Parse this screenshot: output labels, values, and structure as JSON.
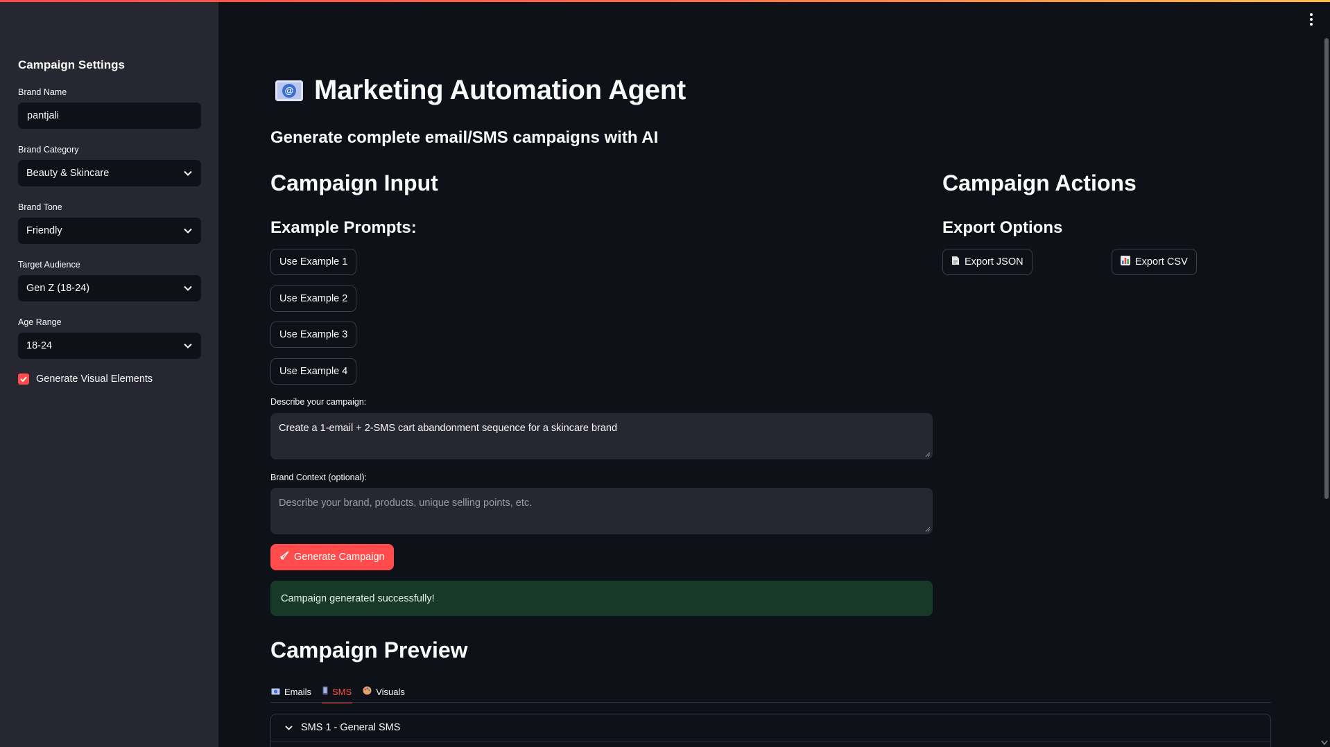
{
  "sidebar": {
    "title": "Campaign Settings",
    "brand_name": {
      "label": "Brand Name",
      "value": "pantjali"
    },
    "brand_category": {
      "label": "Brand Category",
      "value": "Beauty & Skincare"
    },
    "brand_tone": {
      "label": "Brand Tone",
      "value": "Friendly"
    },
    "target_audience": {
      "label": "Target Audience",
      "value": "Gen Z (18-24)"
    },
    "age_range": {
      "label": "Age Range",
      "value": "18-24"
    },
    "generate_visuals": {
      "label": "Generate Visual Elements",
      "checked": true
    }
  },
  "header": {
    "title": "Marketing Automation Agent",
    "subtitle": "Generate complete email/SMS campaigns with AI",
    "icon": "email-icon"
  },
  "campaign_input": {
    "heading": "Campaign Input",
    "examples_heading": "Example Prompts:",
    "examples": [
      "Use Example 1",
      "Use Example 2",
      "Use Example 3",
      "Use Example 4"
    ],
    "describe_label": "Describe your campaign:",
    "describe_value": "Create a 1-email + 2-SMS cart abandonment sequence for a skincare brand",
    "context_label": "Brand Context (optional):",
    "context_placeholder": "Describe your brand, products, unique selling points, etc.",
    "generate_button": "Generate Campaign",
    "success_message": "Campaign generated successfully!"
  },
  "campaign_actions": {
    "heading": "Campaign Actions",
    "export_heading": "Export Options",
    "export_json": "Export JSON",
    "export_csv": "Export CSV"
  },
  "preview": {
    "heading": "Campaign Preview",
    "tabs": [
      {
        "label": "Emails",
        "icon": "email-icon",
        "active": false
      },
      {
        "label": "SMS",
        "icon": "phone-icon",
        "active": true
      },
      {
        "label": "Visuals",
        "icon": "palette-icon",
        "active": false
      }
    ],
    "expander_title": "SMS 1 - General SMS"
  },
  "colors": {
    "primary": "#ff4b4b",
    "background": "#0e1117",
    "sidebar": "#262730",
    "success_bg": "#173928"
  }
}
